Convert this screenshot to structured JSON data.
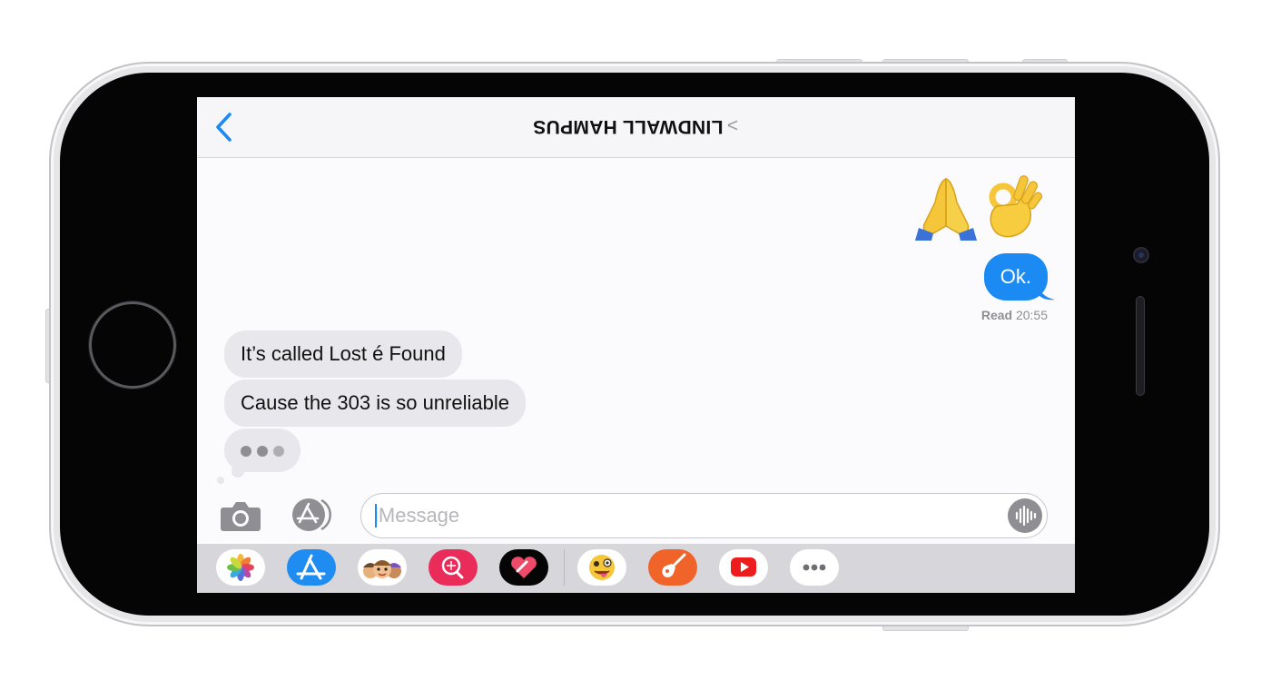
{
  "nav": {
    "back_icon": "chevron-left-icon",
    "contact_name": "LINDWALL HAMPUS",
    "contact_chevron": "<"
  },
  "messages": {
    "sent_emoji": [
      "folded-hands-emoji",
      "ok-hand-emoji"
    ],
    "sent_text": "Ok.",
    "read_receipt": {
      "label": "Read",
      "time": "20:55"
    },
    "received": [
      "It’s called Lost é Found",
      "Cause the 303 is so unreliable"
    ],
    "typing_indicator": "typing-dots"
  },
  "compose": {
    "camera_icon": "camera-icon",
    "apps_icon": "app-store-icon",
    "placeholder": "iMessage",
    "value": "",
    "audio_icon": "waveform-icon"
  },
  "app_drawer": {
    "items": [
      "photos-app-icon",
      "app-store-app-icon",
      "memoji-app-icon",
      "search-images-app-icon",
      "digital-touch-app-icon",
      "animoji-app-icon",
      "garageband-app-icon",
      "youtube-app-icon",
      "more-apps-icon"
    ]
  },
  "colors": {
    "accent": "#1b8af3",
    "incoming_bubble": "#e7e7ec",
    "drawer_background": "#d6d6db"
  }
}
